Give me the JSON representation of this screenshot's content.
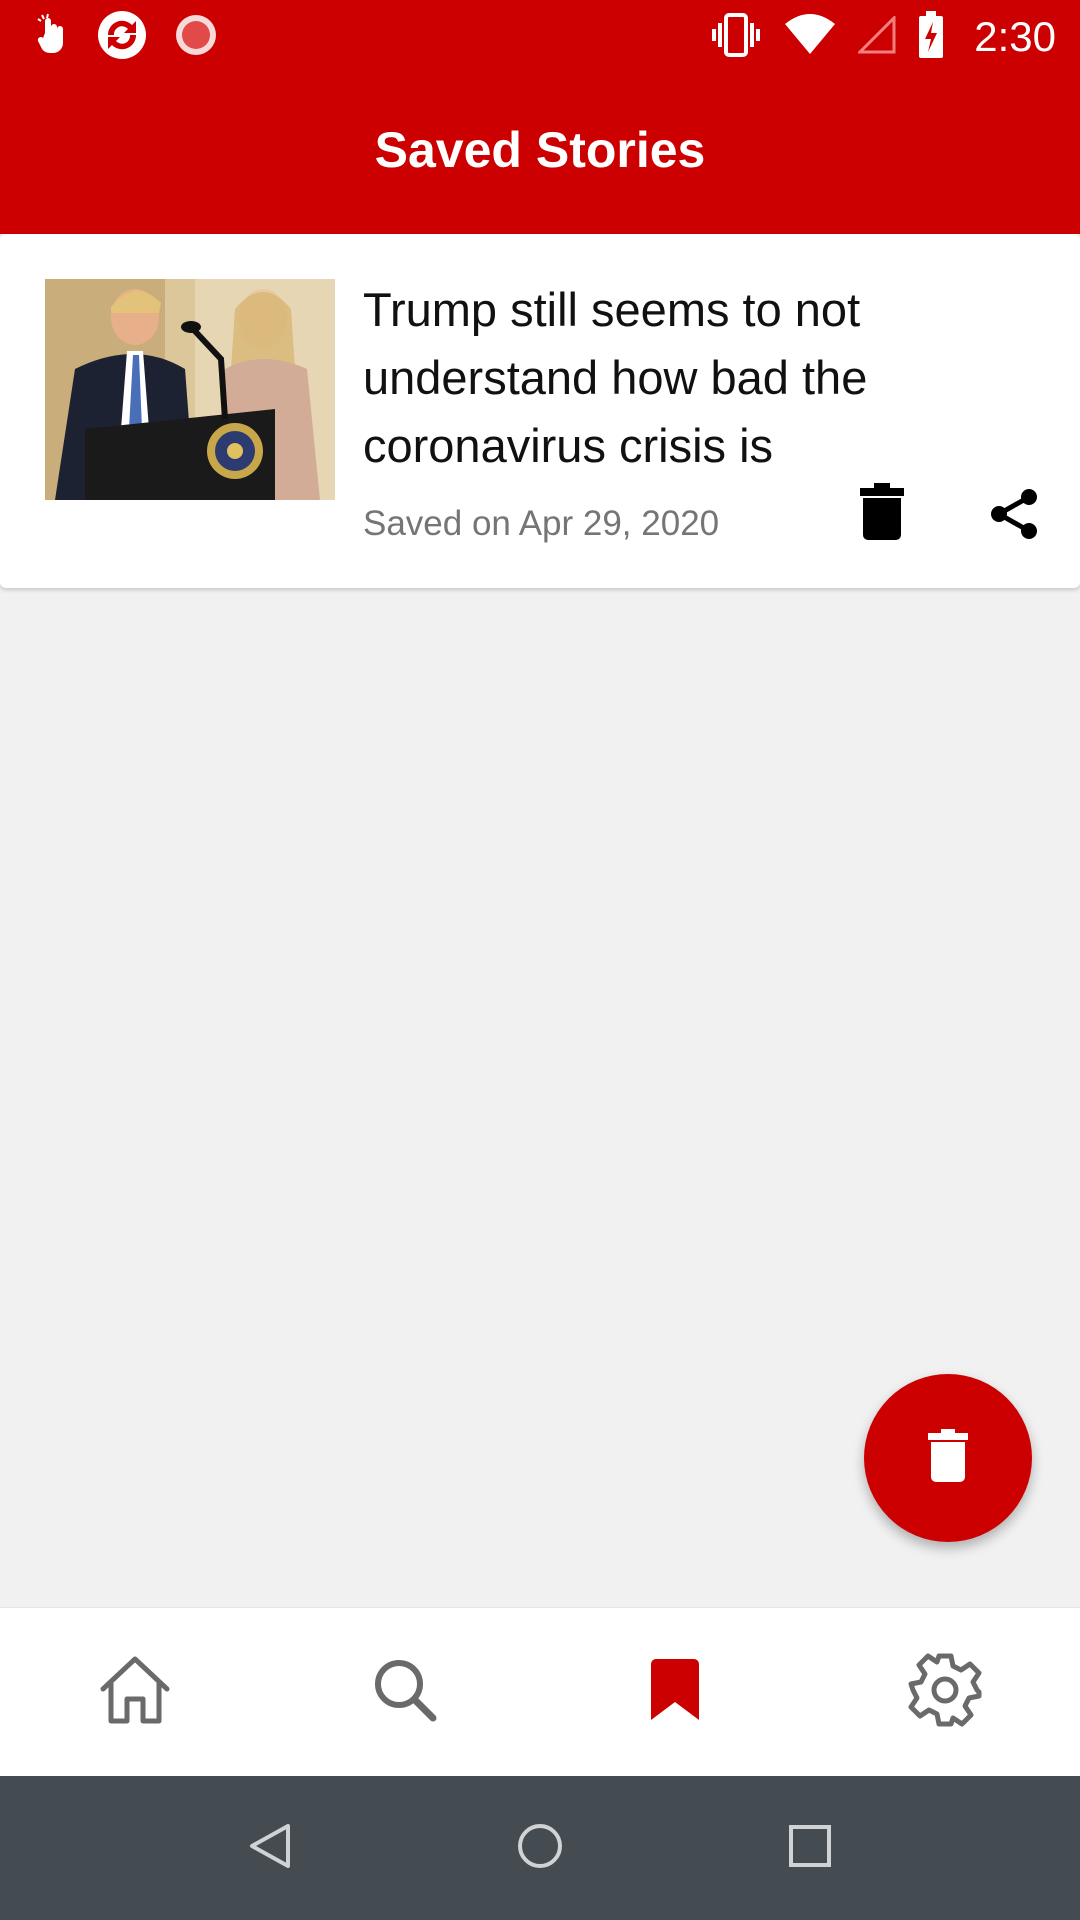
{
  "status_bar": {
    "time": "2:30",
    "icons": [
      "hand-notification-icon",
      "sync-app-icon",
      "record-icon",
      "vibrate-icon",
      "wifi-icon",
      "signal-icon",
      "battery-charging-icon"
    ]
  },
  "app_bar": {
    "title": "Saved Stories"
  },
  "stories": [
    {
      "headline": "Trump still seems to not understand how bad the coronavirus crisis is",
      "saved_label": "Saved on Apr 29, 2020"
    }
  ],
  "bottom_nav": {
    "items": [
      "home-icon",
      "search-icon",
      "bookmark-icon",
      "settings-icon"
    ],
    "active": "bookmark-icon"
  },
  "system_nav": {
    "items": [
      "back-icon",
      "home-circle-icon",
      "recents-icon"
    ]
  },
  "colors": {
    "brand": "#cc0000",
    "background": "#f1f1f1",
    "system_nav": "#454c51"
  }
}
